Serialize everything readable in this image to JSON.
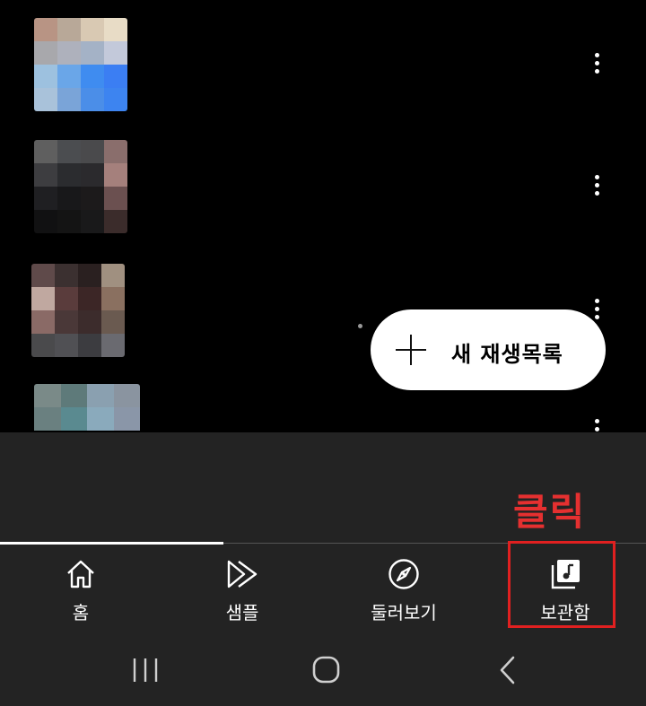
{
  "playlist_rows": [
    {
      "thumb": [
        "#b89484",
        "#b8a898",
        "#d9c9b3",
        "#e8dcc6",
        "#a8a8ac",
        "#aeb1bc",
        "#a4b2c6",
        "#c3c9da",
        "#9dc1df",
        "#6aa6e8",
        "#3f8cf0",
        "#3b7ef3",
        "#a9c2da",
        "#7aa4d8",
        "#4b8ee8",
        "#3d84f0"
      ]
    },
    {
      "thumb": [
        "#5f5f5f",
        "#4b4d50",
        "#4a4a4c",
        "#8a6e6c",
        "#3d3d40",
        "#2b2c2f",
        "#2b2a2d",
        "#a5807c",
        "#1f1f22",
        "#18181a",
        "#1c1a1b",
        "#6b5050",
        "#111112",
        "#141414",
        "#19191a",
        "#3b2c2b"
      ]
    },
    {
      "thumb": [
        "#5f4a4a",
        "#3b3030",
        "#2a2020",
        "#a09080",
        "#c0a8a0",
        "#5a3c3c",
        "#3c2626",
        "#8a7060",
        "#8a6a66",
        "#4a3838",
        "#3c2c2c",
        "#6a5a50",
        "#4a4a4c",
        "#505054",
        "#3c3c40",
        "#6a6a70"
      ]
    },
    {
      "thumb": [
        "#7a8a88",
        "#5e7a7a",
        "#8aa0b0",
        "#8a94a0",
        "#6a8080",
        "#5a8a90",
        "#8aaabc",
        "#8a96a8",
        "#000000",
        "#000000",
        "#000000",
        "#000000",
        "#000000",
        "#000000",
        "#000000",
        "#000000"
      ]
    }
  ],
  "fab": {
    "label": "새 재생목록"
  },
  "annotation": {
    "text": "클릭"
  },
  "tabs": [
    {
      "label": "홈",
      "icon": "home-icon"
    },
    {
      "label": "샘플",
      "icon": "samples-play-icon"
    },
    {
      "label": "둘러보기",
      "icon": "compass-icon"
    },
    {
      "label": "보관함",
      "icon": "library-music-icon"
    }
  ],
  "colors": {
    "background": "#000000",
    "panel": "#232323",
    "highlight": "#e02020"
  }
}
